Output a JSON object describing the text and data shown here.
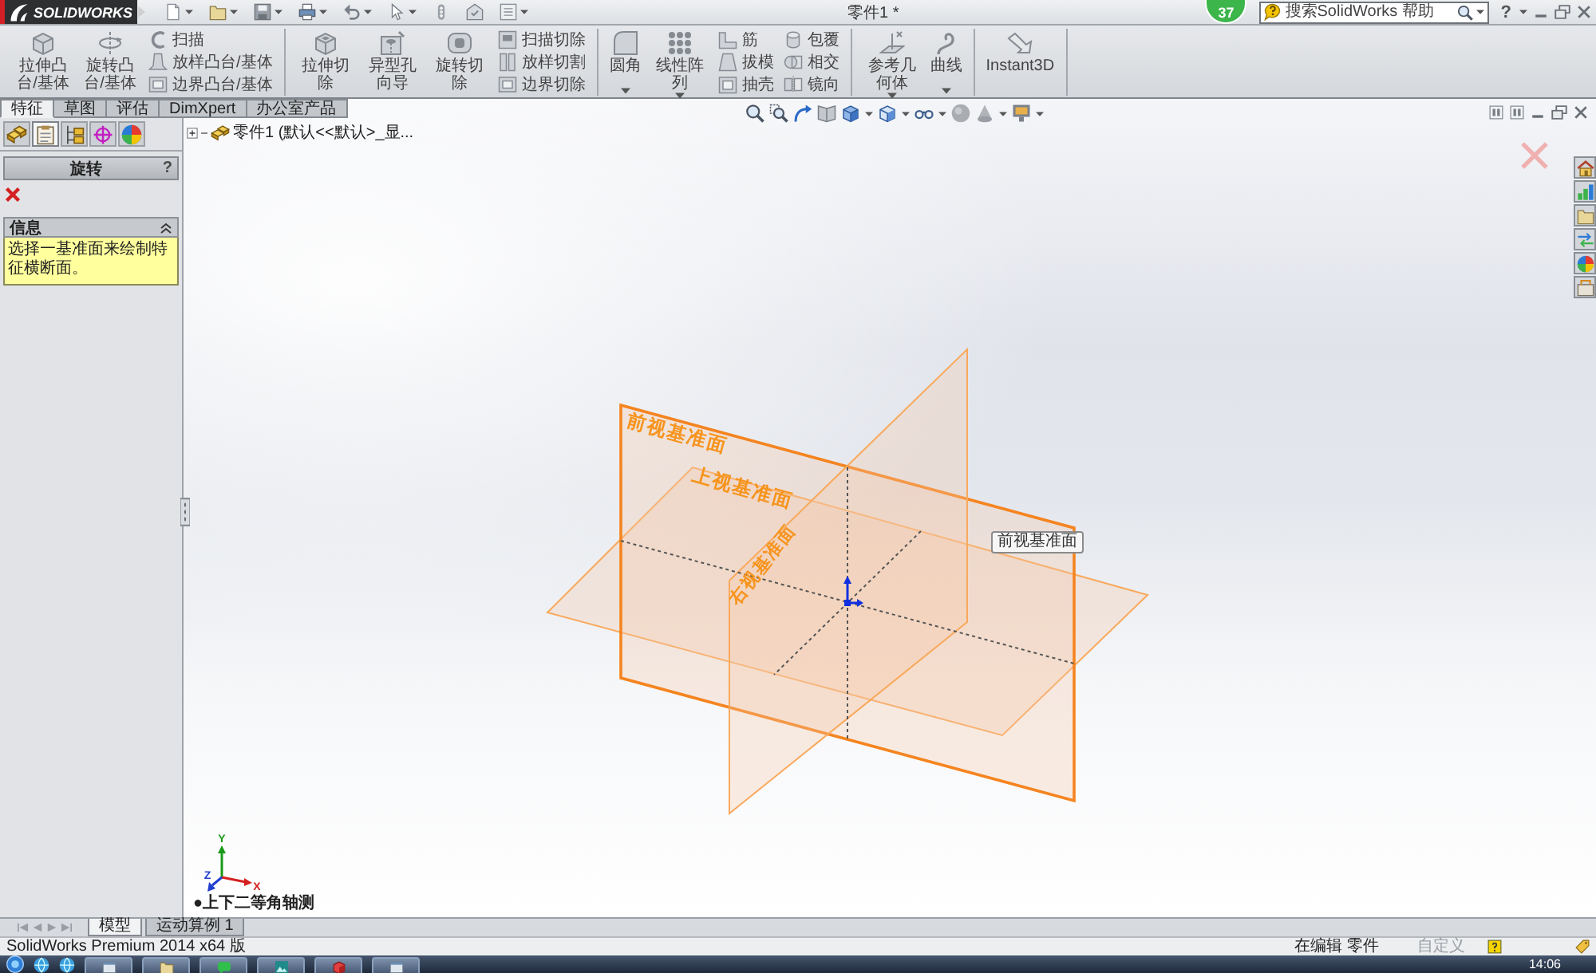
{
  "title_bar": {
    "logo": "SOLIDWORKS",
    "title": "零件1 *",
    "badge": "37",
    "search": {
      "placeholder": "搜索SolidWorks 帮助"
    },
    "help": "?"
  },
  "ribbon": {
    "groups": [
      {
        "items": [
          {
            "kind": "large",
            "label": "拉伸凸台/基体",
            "dropdown": false
          },
          {
            "kind": "large",
            "label": "旋转凸台/基体",
            "dropdown": false
          },
          {
            "kind": "stack",
            "entries": [
              "扫描",
              "放样凸台/基体",
              "边界凸台/基体"
            ]
          }
        ]
      },
      {
        "items": [
          {
            "kind": "large",
            "label": "拉伸切除",
            "dropdown": false
          },
          {
            "kind": "large",
            "label": "异型孔向导",
            "dropdown": false
          },
          {
            "kind": "large",
            "label": "旋转切除",
            "dropdown": false
          },
          {
            "kind": "stack",
            "entries": [
              "扫描切除",
              "放样切割",
              "边界切除"
            ]
          }
        ]
      },
      {
        "items": [
          {
            "kind": "large",
            "label": "圆角",
            "dropdown": true
          },
          {
            "kind": "large",
            "label": "线性阵列",
            "dropdown": true
          },
          {
            "kind": "stack",
            "entries": [
              "筋",
              "拔模",
              "抽壳"
            ]
          },
          {
            "kind": "stack",
            "entries": [
              "包覆",
              "相交",
              "镜向"
            ]
          }
        ]
      },
      {
        "items": [
          {
            "kind": "large",
            "label": "参考几何体",
            "dropdown": true
          },
          {
            "kind": "large",
            "label": "曲线",
            "dropdown": true
          }
        ]
      },
      {
        "items": [
          {
            "kind": "large",
            "label": "Instant3D",
            "dropdown": false
          }
        ]
      }
    ]
  },
  "command_tabs": [
    {
      "label": "特征",
      "selected": true
    },
    {
      "label": "草图",
      "selected": false
    },
    {
      "label": "评估",
      "selected": false
    },
    {
      "label": "DimXpert",
      "selected": false
    },
    {
      "label": "办公室产品",
      "selected": false
    }
  ],
  "manager_tabs": [
    {
      "selected": false
    },
    {
      "selected": true
    },
    {
      "selected": false
    },
    {
      "selected": false
    },
    {
      "selected": false
    }
  ],
  "property_manager": {
    "title": "旋转",
    "help": "?",
    "group": {
      "title": "信息",
      "expanded": true,
      "message": "选择一基准面来绘制特征横断面。"
    }
  },
  "feature_tree": {
    "root": "零件1 (默认<<默认>_显..."
  },
  "planes": [
    {
      "kind": "front",
      "label": "前视基准面",
      "highlighted": true
    },
    {
      "kind": "top",
      "label": "上视基准面",
      "highlighted": false
    },
    {
      "kind": "right",
      "label": "右视基准面",
      "highlighted": false
    }
  ],
  "tooltip": "前视基准面",
  "triad": {
    "axes": [
      {
        "kind": "y",
        "label": "Y"
      },
      {
        "kind": "x",
        "label": "X"
      },
      {
        "kind": "z",
        "label": "Z"
      }
    ]
  },
  "view_name": "●上下二等角轴测",
  "bottom_tabs": [
    {
      "label": "模型",
      "selected": true
    },
    {
      "label": "运动算例 1",
      "selected": false
    }
  ],
  "status_bar": {
    "product": "SolidWorks Premium 2014 x64 版",
    "mode": "在编辑 零件",
    "custom": {
      "label": "自定义",
      "disabled": true
    }
  },
  "taskbar": {
    "clock": "14:06"
  }
}
